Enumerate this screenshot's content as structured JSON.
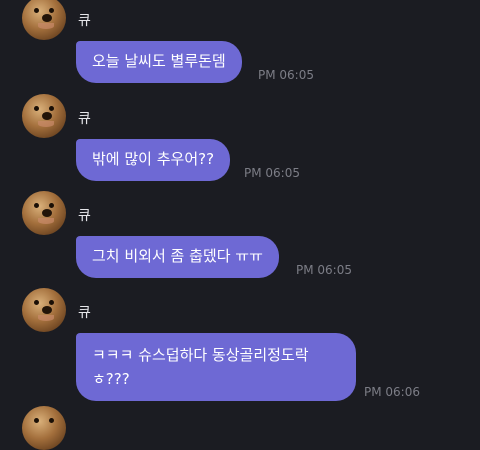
{
  "messages": [
    {
      "sender": "큐",
      "text": "오늘 날씨도 별루돈뎀",
      "time": "PM 06:05"
    },
    {
      "sender": "큐",
      "text": "밖에 많이 추우어??",
      "time": "PM 06:05"
    },
    {
      "sender": "큐",
      "text": "그치 비외서 좀 춥뎄다 ㅠㅠ",
      "time": "PM 06:05"
    },
    {
      "sender": "큐",
      "text": "ㅋㅋㅋ 슈스덥하다 동상골리정도락 ㅎ???",
      "time": "PM 06:06"
    }
  ],
  "colors": {
    "background": "#1b1c22",
    "bubble": "#6e69d4",
    "time": "#7c7d86",
    "name": "#e6e6ea"
  },
  "icons": {
    "avatar": "dog-avatar"
  }
}
